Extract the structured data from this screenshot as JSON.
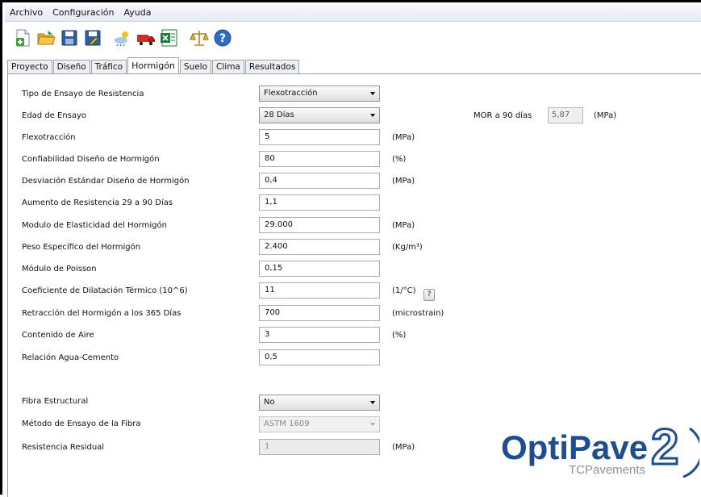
{
  "menu": [
    "Archivo",
    "Configuración",
    "Ayuda"
  ],
  "toolbar": {
    "icons": [
      "new-file-icon",
      "open-folder-icon",
      "save-icon",
      "save-as-icon",
      "weather-icon",
      "truck-icon",
      "excel-export-icon",
      "scale-balance-icon",
      "help-icon"
    ]
  },
  "tabs": [
    "Proyecto",
    "Diseño",
    "Tráfico",
    "Hormigón",
    "Suelo",
    "Clima",
    "Resultados"
  ],
  "active_tab": "Hormigón",
  "form": {
    "tipo_ensayo": {
      "label": "Tipo de Ensayo de Resistencia",
      "value": "Flexotracción"
    },
    "edad_ensayo": {
      "label": "Edad de Ensayo",
      "value": "28 Días"
    },
    "mor": {
      "label": "MOR a 90 días",
      "value": "5,87",
      "unit": "(MPa)"
    },
    "flexotraccion": {
      "label": "Flexotracción",
      "value": "5",
      "unit": "(MPa)"
    },
    "confiabilidad": {
      "label": "Confiabilidad Diseño de Hormigón",
      "value": "80",
      "unit": "(%)"
    },
    "desviacion": {
      "label": "Desviación Estándar Diseño de Hormigón",
      "value": "0,4",
      "unit": "(MPa)"
    },
    "aumento": {
      "label": "Aumento de Resistencia 29 a 90 Días",
      "value": "1,1"
    },
    "modulo_elasticidad": {
      "label": "Modulo de Elasticidad del Hormigón",
      "value": "29.000",
      "unit": "(MPa)"
    },
    "peso_especifico": {
      "label": "Peso Específico del Hormigón",
      "value": "2.400",
      "unit": "(Kg/m³)"
    },
    "poisson": {
      "label": "Módulo de Poisson",
      "value": "0,15"
    },
    "dilatacion": {
      "label": "Coeficiente de Dilatación Térmico (10^6)",
      "value": "11",
      "unit": "(1/°C)",
      "help": "?"
    },
    "retraccion": {
      "label": "Retracción del Hormigón a los 365 Días",
      "value": "700",
      "unit": "(microstrain)"
    },
    "aire": {
      "label": "Contenido de Aire",
      "value": "3",
      "unit": "(%)"
    },
    "agua_cemento": {
      "label": "Relación Agua-Cemento",
      "value": "0,5"
    },
    "fibra": {
      "label": "Fibra Estructural",
      "value": "No"
    },
    "metodo_fibra": {
      "label": "Método de Ensayo de la Fibra",
      "value": "ASTM 1609"
    },
    "resistencia_residual": {
      "label": "Resistencia Residual",
      "value": "1",
      "unit": "(MPa)"
    }
  },
  "logo": {
    "name": "OptiPave",
    "version": "2",
    "company": "TCPavements",
    "brand_color": "#1d4f8f"
  },
  "colors": {
    "accent": "#2a5fa8"
  }
}
